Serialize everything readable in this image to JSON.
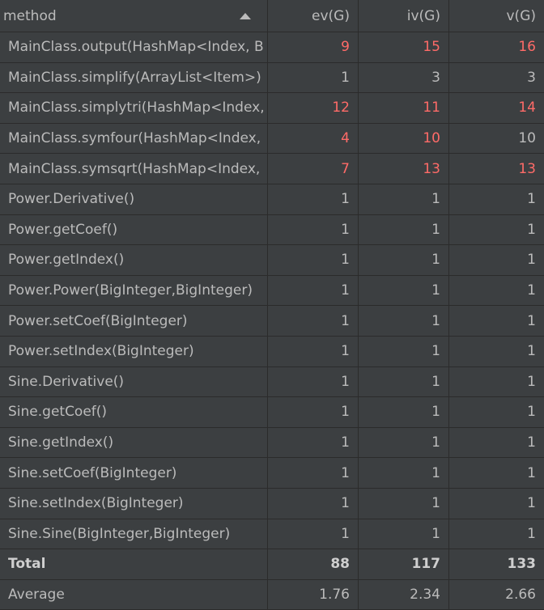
{
  "columns": {
    "method": "method",
    "ev": "ev(G)",
    "iv": "iv(G)",
    "v": "v(G)"
  },
  "rows": [
    {
      "method": "MainClass.output(HashMap<Index, B",
      "ev": "9",
      "iv": "15",
      "v": "16",
      "ev_red": true,
      "iv_red": true,
      "v_red": true
    },
    {
      "method": "MainClass.simplify(ArrayList<Item>)",
      "ev": "1",
      "iv": "3",
      "v": "3",
      "ev_red": false,
      "iv_red": false,
      "v_red": false
    },
    {
      "method": "MainClass.simplytri(HashMap<Index,",
      "ev": "12",
      "iv": "11",
      "v": "14",
      "ev_red": true,
      "iv_red": true,
      "v_red": true
    },
    {
      "method": "MainClass.symfour(HashMap<Index,",
      "ev": "4",
      "iv": "10",
      "v": "10",
      "ev_red": true,
      "iv_red": true,
      "v_red": false
    },
    {
      "method": "MainClass.symsqrt(HashMap<Index,",
      "ev": "7",
      "iv": "13",
      "v": "13",
      "ev_red": true,
      "iv_red": true,
      "v_red": true
    },
    {
      "method": "Power.Derivative()",
      "ev": "1",
      "iv": "1",
      "v": "1"
    },
    {
      "method": "Power.getCoef()",
      "ev": "1",
      "iv": "1",
      "v": "1"
    },
    {
      "method": "Power.getIndex()",
      "ev": "1",
      "iv": "1",
      "v": "1"
    },
    {
      "method": "Power.Power(BigInteger,BigInteger)",
      "ev": "1",
      "iv": "1",
      "v": "1"
    },
    {
      "method": "Power.setCoef(BigInteger)",
      "ev": "1",
      "iv": "1",
      "v": "1"
    },
    {
      "method": "Power.setIndex(BigInteger)",
      "ev": "1",
      "iv": "1",
      "v": "1"
    },
    {
      "method": "Sine.Derivative()",
      "ev": "1",
      "iv": "1",
      "v": "1"
    },
    {
      "method": "Sine.getCoef()",
      "ev": "1",
      "iv": "1",
      "v": "1"
    },
    {
      "method": "Sine.getIndex()",
      "ev": "1",
      "iv": "1",
      "v": "1"
    },
    {
      "method": "Sine.setCoef(BigInteger)",
      "ev": "1",
      "iv": "1",
      "v": "1"
    },
    {
      "method": "Sine.setIndex(BigInteger)",
      "ev": "1",
      "iv": "1",
      "v": "1"
    },
    {
      "method": "Sine.Sine(BigInteger,BigInteger)",
      "ev": "1",
      "iv": "1",
      "v": "1"
    }
  ],
  "total": {
    "label": "Total",
    "ev": "88",
    "iv": "117",
    "v": "133"
  },
  "average": {
    "label": "Average",
    "ev": "1.76",
    "iv": "2.34",
    "v": "2.66"
  },
  "colors": {
    "background": "#3c3f41",
    "grid": "#2b2b2b",
    "text": "#bbbbbb",
    "highlight": "#ff6b68"
  }
}
